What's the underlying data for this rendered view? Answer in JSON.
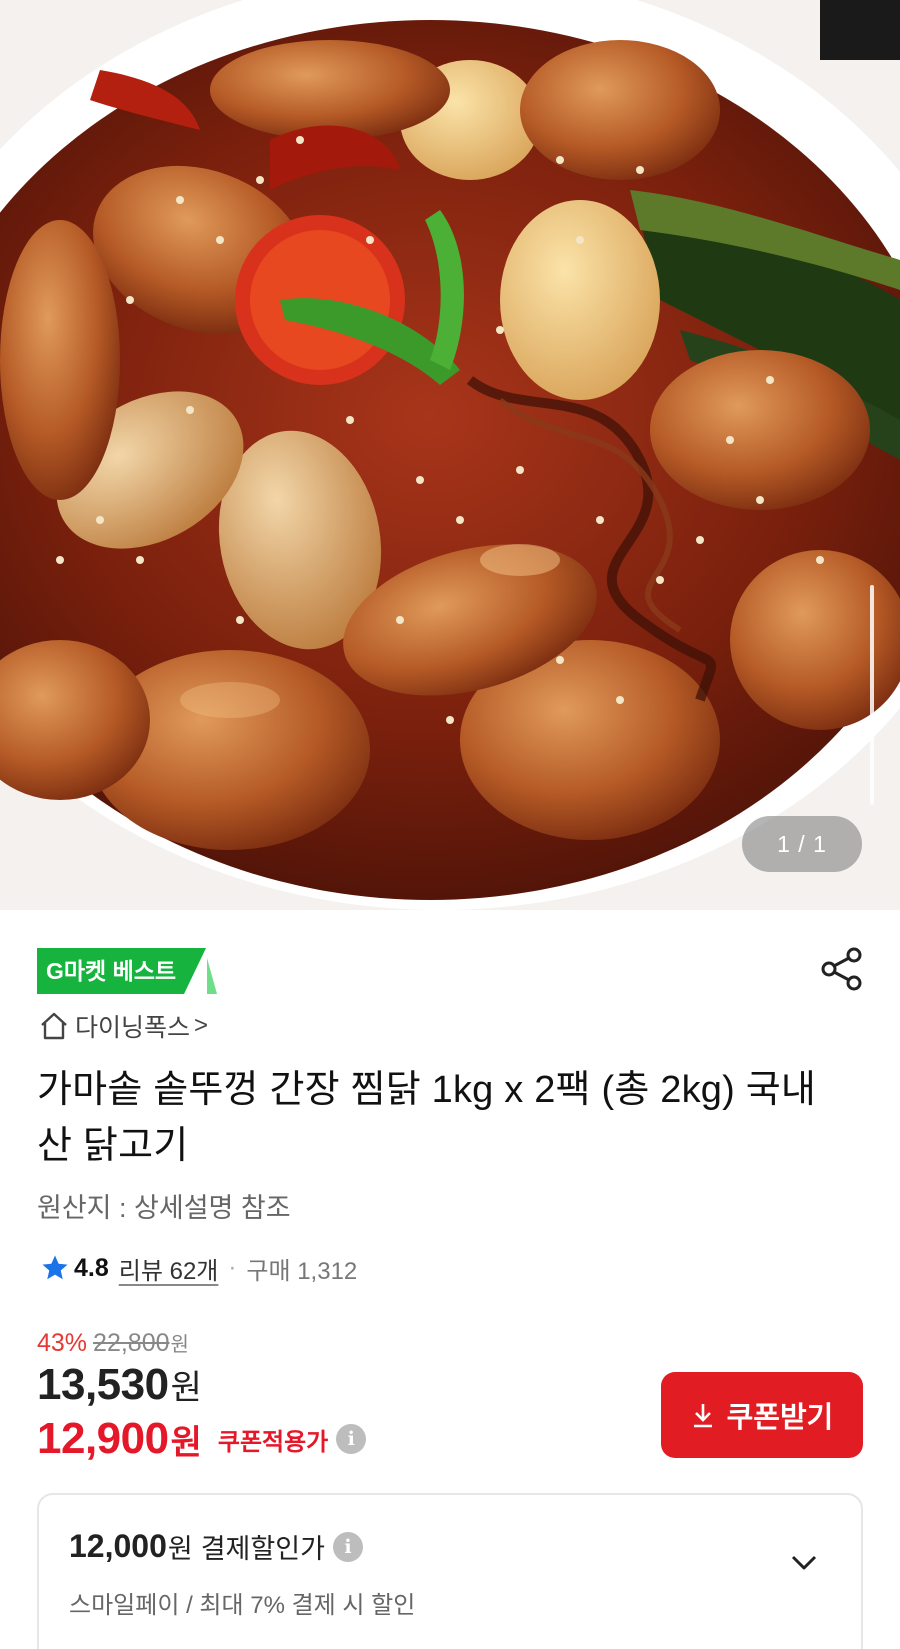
{
  "hero": {
    "page_indicator": "1 / 1",
    "image_description_icon": "food-photo"
  },
  "badge": {
    "label": "G마켓 베스트",
    "color": "#16b43e"
  },
  "share": {
    "icon": "share-icon"
  },
  "brand": {
    "home_icon": "home-icon",
    "name": "다이닝폭스",
    "chevron": ">"
  },
  "product": {
    "title": "가마솥 솥뚜껑 간장 찜닭 1kg x 2팩 (총 2kg) 국내산 닭고기",
    "origin": "원산지 : 상세설명 참조"
  },
  "rating": {
    "score": "4.8",
    "review_label": "리뷰 62개",
    "separator": "·",
    "purchase_label": "구매 1,312",
    "star_color": "#1a73e8"
  },
  "pricing": {
    "discount_percent": "43%",
    "original_price": "22,800",
    "original_unit": "원",
    "sale_price": "13,530",
    "sale_unit": "원",
    "coupon_price": "12,900",
    "coupon_unit": "원",
    "coupon_label": "쿠폰적용가",
    "info_glyph": "i",
    "accent_color": "#e5182a"
  },
  "coupon_button": {
    "label": "쿠폰받기",
    "icon": "download-icon",
    "color": "#e11c22"
  },
  "payment": {
    "amount": "12,000",
    "unit": "원",
    "label": "결제할인가",
    "info_glyph": "i",
    "sub": "스마일페이 / 최대 7% 결제 시 할인",
    "chevron_icon": "chevron-down-icon"
  }
}
